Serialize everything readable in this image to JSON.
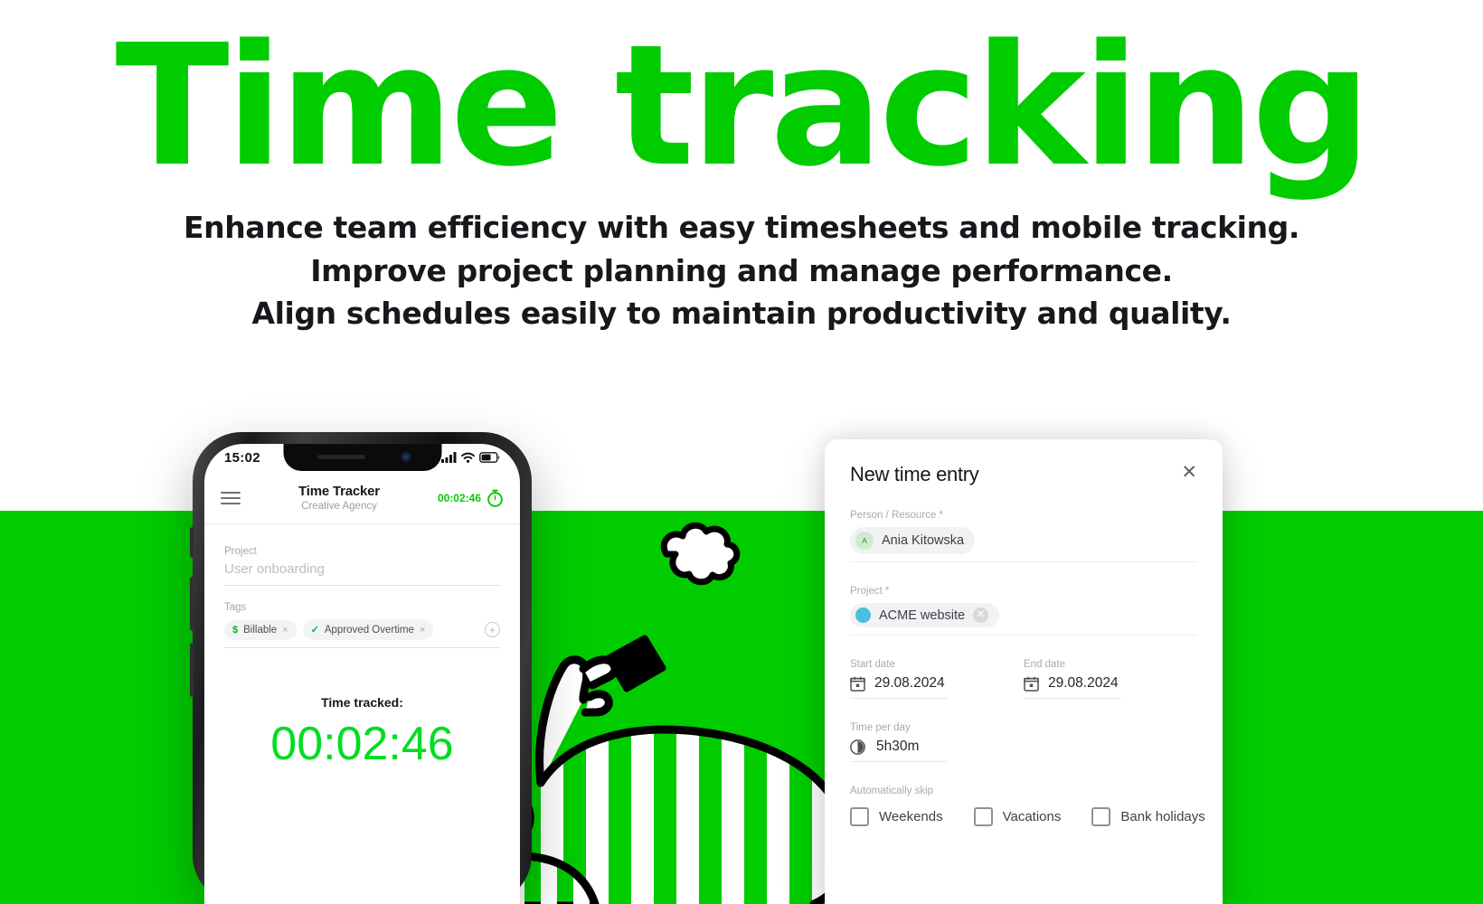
{
  "hero": {
    "title": "Time tracking",
    "subtitle_lines": [
      "Enhance team efficiency with easy timesheets and mobile tracking.",
      "Improve project planning and manage performance.",
      "Align schedules easily to maintain productivity and quality."
    ]
  },
  "colors": {
    "brand_green": "#00cc00",
    "timer_green": "#00dd22",
    "project_dot": "#49bede",
    "avatar_bg": "#cdeccd",
    "text_dark": "#16181c"
  },
  "phone": {
    "status": {
      "time": "15:02",
      "signal_icon": "cellular-bars-icon",
      "wifi_icon": "wifi-icon",
      "battery_icon": "battery-icon"
    },
    "header": {
      "menu_icon": "hamburger-menu-icon",
      "title": "Time Tracker",
      "subtitle": "Creative Agency",
      "timer_value": "00:02:46",
      "timer_icon": "stopwatch-icon"
    },
    "project": {
      "label": "Project",
      "value": "User onboarding"
    },
    "tags": {
      "label": "Tags",
      "items": [
        {
          "icon": "dollar-icon",
          "glyph": "$",
          "label": "Billable",
          "remove": "×"
        },
        {
          "icon": "check-icon",
          "glyph": "✓",
          "label": "Approved Overtime",
          "remove": "×"
        }
      ],
      "add_icon": "plus-circle-icon",
      "add_glyph": "+"
    },
    "tracked": {
      "label": "Time tracked:",
      "value": "00:02:46"
    }
  },
  "dialog": {
    "title": "New time entry",
    "close_icon": "close-icon",
    "close_glyph": "✕",
    "person": {
      "label": "Person / Resource *",
      "avatar_initial": "A",
      "name": "Ania Kitowska"
    },
    "project": {
      "label": "Project *",
      "name": "ACME website",
      "dot_icon": "project-color-dot-icon",
      "remove_icon": "remove-token-icon",
      "remove_glyph": "✕"
    },
    "start_date": {
      "label": "Start date",
      "value": "29.08.2024",
      "icon": "calendar-icon"
    },
    "end_date": {
      "label": "End date",
      "value": "29.08.2024",
      "icon": "calendar-icon"
    },
    "time_per_day": {
      "label": "Time per day",
      "value": "5h30m",
      "icon": "clock-icon"
    },
    "skip": {
      "label": "Automatically skip",
      "options": [
        {
          "label": "Weekends",
          "checked": false
        },
        {
          "label": "Vacations",
          "checked": false
        },
        {
          "label": "Bank holidays",
          "checked": false
        }
      ]
    }
  },
  "illustration": {
    "name": "person-reclining-with-phone-illustration",
    "cloud_icon": "cloud-puff-icon"
  }
}
